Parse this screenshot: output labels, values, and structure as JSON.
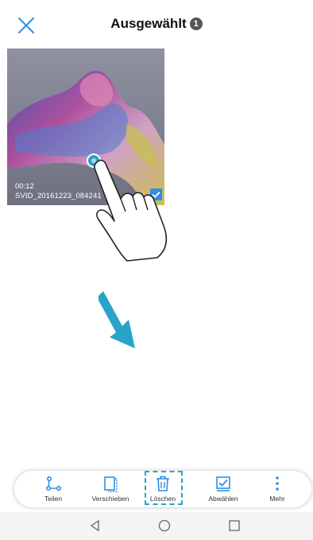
{
  "header": {
    "title": "Ausgewählt",
    "count": "1"
  },
  "media_item": {
    "duration": "00:12",
    "filename": "SVID_20161223_084241",
    "selected": true
  },
  "toolbar": {
    "items": [
      {
        "label": "Teilen",
        "icon": "share-icon"
      },
      {
        "label": "Verschieben",
        "icon": "move-icon"
      },
      {
        "label": "Löschen",
        "icon": "trash-icon"
      },
      {
        "label": "Abwählen",
        "icon": "deselect-icon"
      },
      {
        "label": "Mehr",
        "icon": "more-vertical-icon"
      }
    ]
  },
  "colors": {
    "accent": "#2f8de4",
    "arrow": "#2aa3c9",
    "highlight": "#2aa3c9"
  }
}
